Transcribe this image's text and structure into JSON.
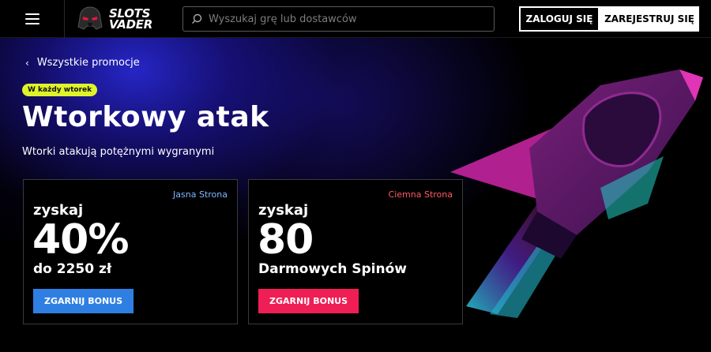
{
  "header": {
    "logo_line1": "SLOTS",
    "logo_line2": "VADER",
    "search_placeholder": "Wyszukaj grę lub dostawców",
    "login_label": "ZALOGUJ SIĘ",
    "register_label": "ZAREJESTRUJ SIĘ"
  },
  "hero": {
    "back_label": "Wszystkie promocje",
    "tag": "W każdy wtorek",
    "title": "Wtorkowy atak",
    "subtitle": "Wtorki atakują potężnymi wygranymi"
  },
  "cards": [
    {
      "side": "Jasna Strona",
      "get": "zyskaj",
      "big": "40%",
      "desc": "do 2250 zł",
      "button": "ZGARNIJ BONUS",
      "accent": "#2f7fe3"
    },
    {
      "side": "Ciemna Strona",
      "get": "zyskaj",
      "big": "80",
      "desc": "Darmowych Spinów",
      "button": "ZGARNIJ BONUS",
      "accent": "#ef1e55"
    }
  ],
  "colors": {
    "tag_bg": "#dff32a",
    "light_side": "#7cb9ff",
    "dark_side": "#ff5a62"
  },
  "icons": {
    "menu": "hamburger-menu-icon",
    "search": "search-icon",
    "back": "chevron-left-icon",
    "logo": "vader-helmet-logo-icon",
    "hero_art": "spaceship-illustration"
  }
}
